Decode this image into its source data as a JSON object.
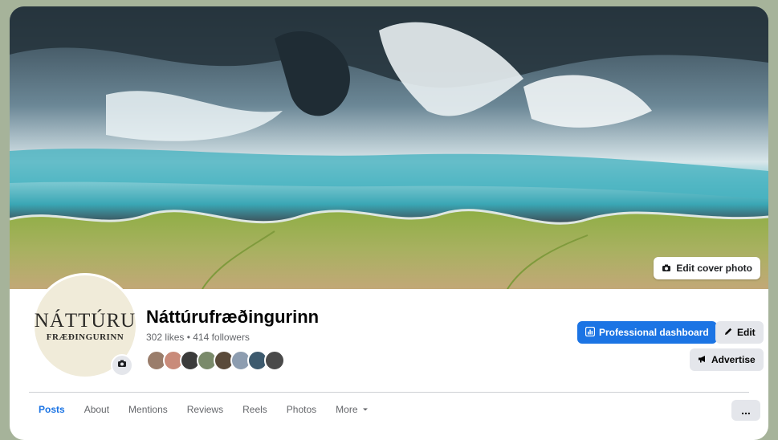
{
  "cover": {
    "edit_label": "Edit cover photo",
    "icon": "camera-icon"
  },
  "profile": {
    "logo_line1": "NÁTTÚRU",
    "logo_line2": "FRÆÐINGURINN",
    "name": "Náttúrufræðingurinn",
    "stats": "302 likes • 414 followers",
    "friend_colors": [
      "#9a7d6b",
      "#c98b7a",
      "#3b3b3b",
      "#7a8a6a",
      "#5a4a3a",
      "#8d9db0",
      "#3d5a6e",
      "#4a4a4a"
    ]
  },
  "actions": {
    "dashboard_label": "Professional dashboard",
    "edit_label": "Edit",
    "advertise_label": "Advertise"
  },
  "tabs": [
    {
      "label": "Posts",
      "active": true
    },
    {
      "label": "About"
    },
    {
      "label": "Mentions"
    },
    {
      "label": "Reviews"
    },
    {
      "label": "Reels"
    },
    {
      "label": "Photos"
    },
    {
      "label": "More"
    }
  ],
  "more_menu_label": "...",
  "colors": {
    "accent": "#1b74e4",
    "background": "#a6b39a"
  }
}
